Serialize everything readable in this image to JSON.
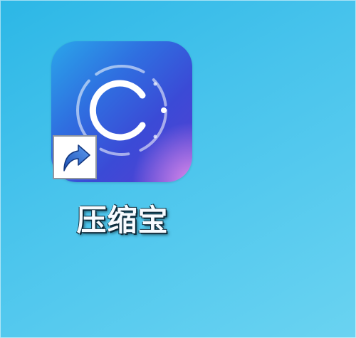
{
  "desktop": {
    "shortcut": {
      "label": "压缩宝",
      "app_icon": "compression-app-logo",
      "overlay_icon": "shortcut-arrow-icon"
    }
  },
  "colors": {
    "desktop_background": "#47c3ec",
    "tile_gradient_start": "#2aa6ea",
    "tile_gradient_mid": "#3b4ad6",
    "tile_corner_glow": "#e48ceb",
    "logo_stroke": "#ffffff",
    "shortcut_arrow": "#2d63c8"
  }
}
